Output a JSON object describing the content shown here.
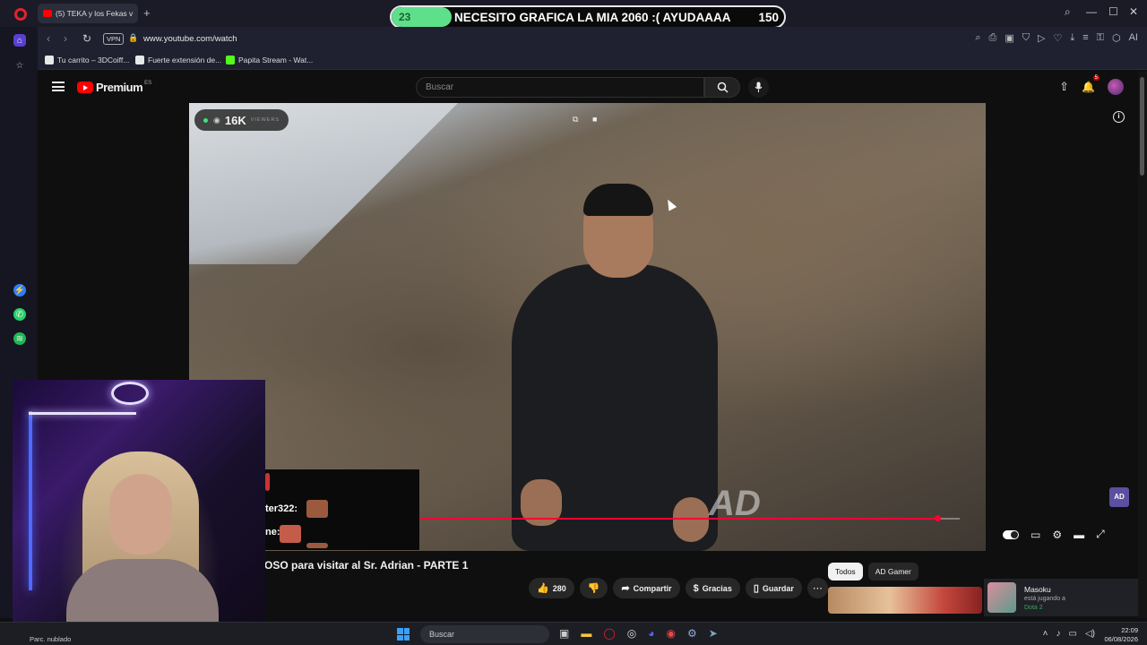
{
  "browser": {
    "tab_title": "(5) TEKA y los Fekas v",
    "url": "www.youtube.com/watch",
    "vpn_label": "VPN",
    "bookmarks": [
      {
        "label": "Tu carrito – 3DCoiff..."
      },
      {
        "label": "Fuerte extensión de..."
      },
      {
        "label": "Papita Stream - Wat..."
      }
    ],
    "extension_icons": [
      "search-icon",
      "camera-icon",
      "wallet-icon",
      "shield-icon",
      "play-icon",
      "heart-icon",
      "download-icon",
      "list-icon",
      "lock-icon",
      "cube-icon",
      "ai-icon"
    ],
    "ai_label": "AI"
  },
  "stream_banner": {
    "current": "23",
    "message": "NECESITO GRAFICA LA MIA 2060 :( AYUDAAAA",
    "goal": "150",
    "progress_fraction": 0.153,
    "accent": "#5ee08a"
  },
  "youtube": {
    "brand": "Premium",
    "region": "ES",
    "search_placeholder": "Buscar",
    "notification_count": "5",
    "viewers_count": "16K",
    "viewers_label": "VIEWERS",
    "watermark": "AD",
    "progress_fraction": 0.968,
    "channel_badge": "AD",
    "video_title": "OSO para visitar al Sr. Adrian - PARTE 1",
    "actions": {
      "likes": "280",
      "share": "Compartir",
      "thanks": "Gracias",
      "save": "Guardar"
    },
    "chips": [
      "Todos",
      "AD Gamer"
    ]
  },
  "stream_chat": {
    "line1_user": "ter322:",
    "line2_user": "ne:"
  },
  "activity": {
    "name": "Masoku",
    "status": "está jugando a",
    "game": "Dota 2"
  },
  "taskbar": {
    "weather": "Parc. nublado",
    "search_placeholder": "Buscar",
    "time": "22:09",
    "date": "06/08/2026"
  }
}
